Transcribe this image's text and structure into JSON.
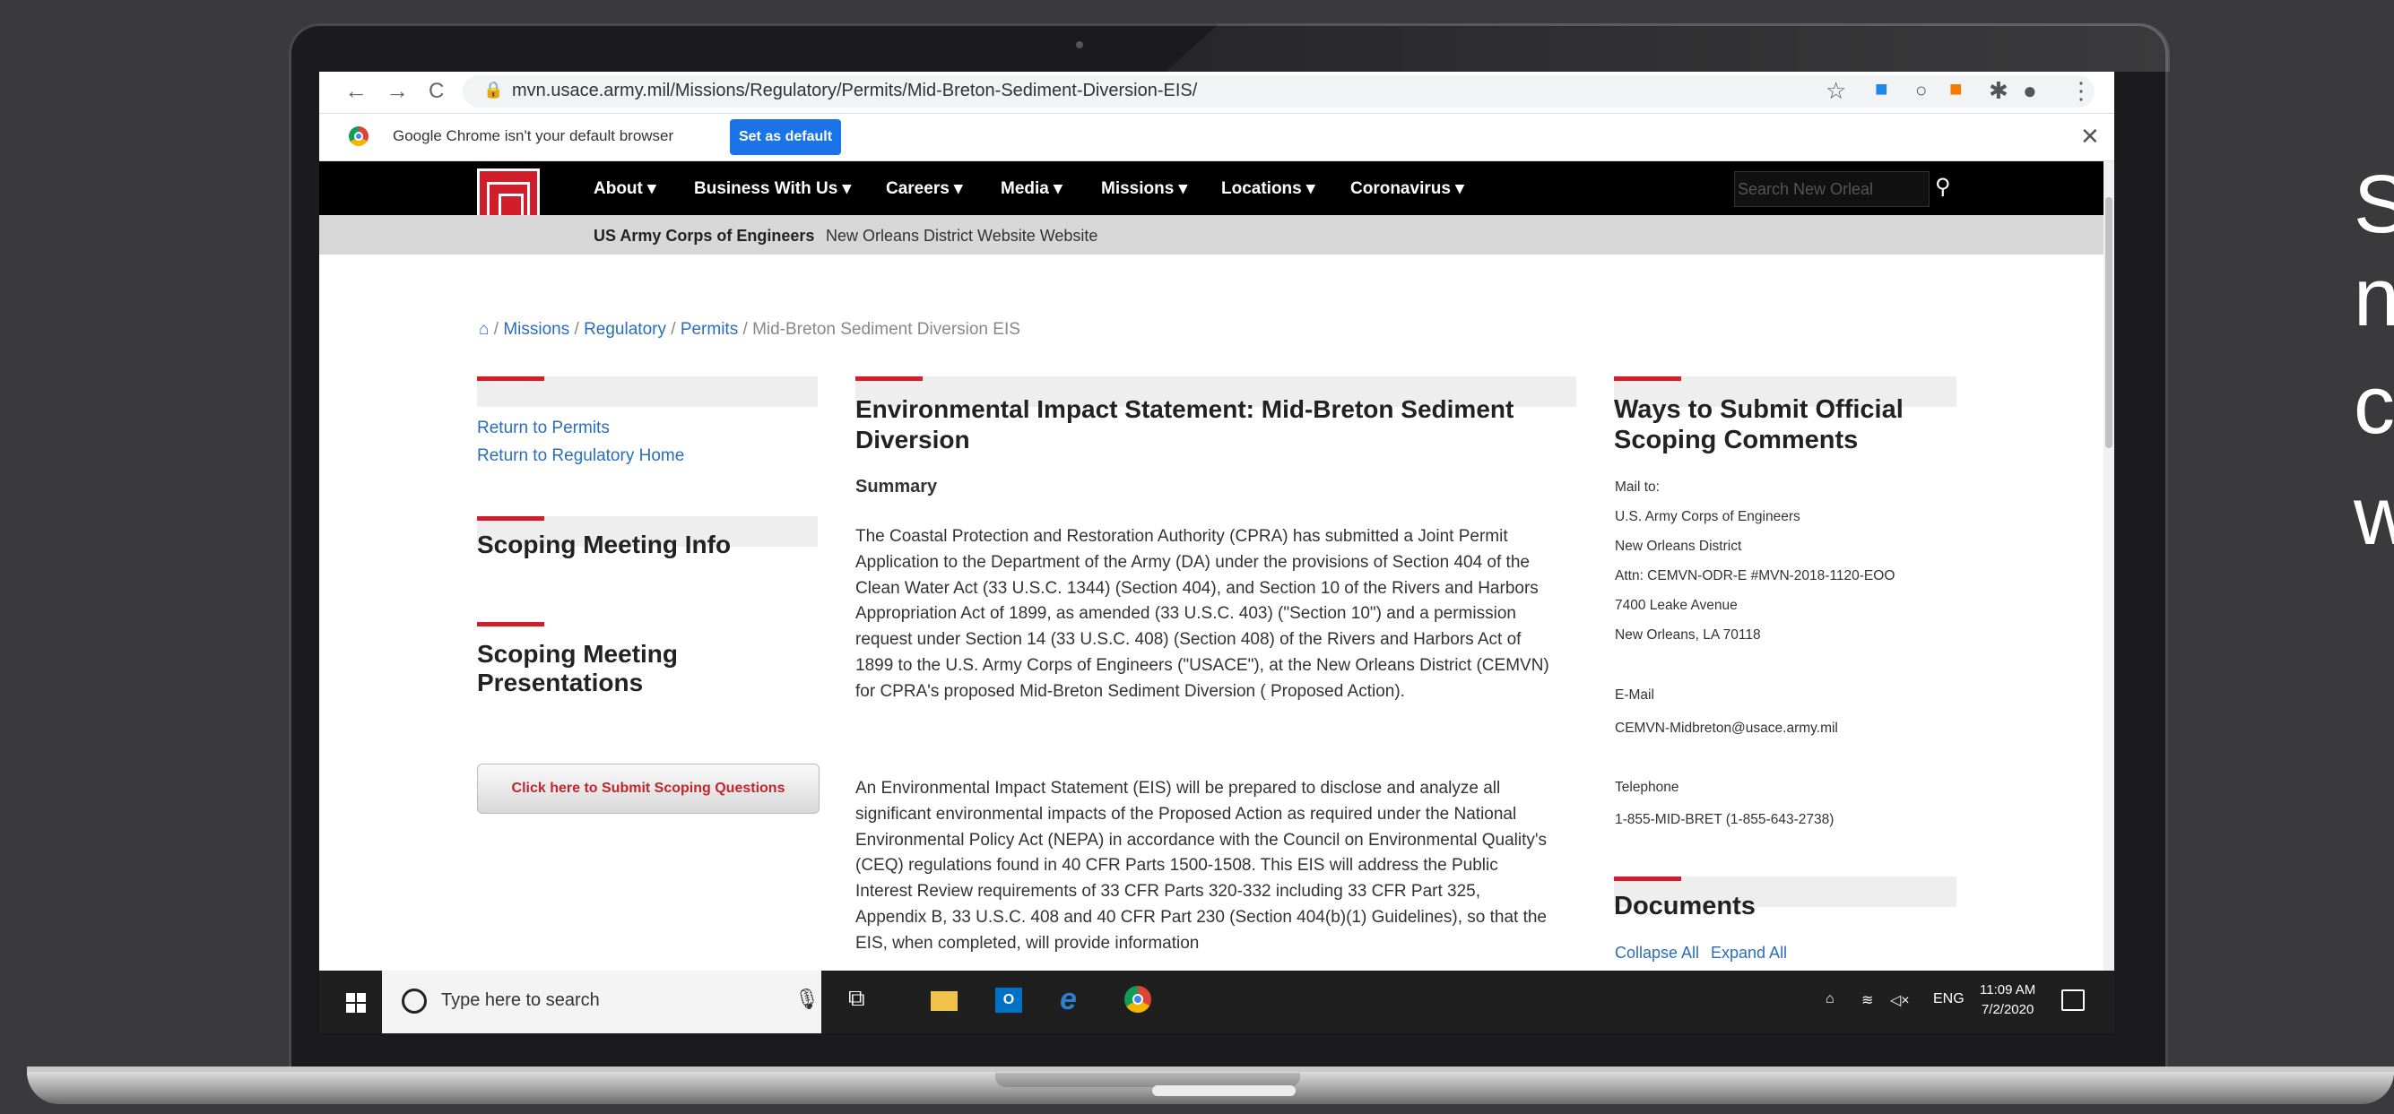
{
  "side_text": [
    "S",
    "n",
    "c",
    "w"
  ],
  "browser": {
    "url": "mvn.usace.army.mil/Missions/Regulatory/Permits/Mid-Breton-Sediment-Diversion-EIS/",
    "infobar_text": "Google Chrome isn't your default browser",
    "set_default_label": "Set as default"
  },
  "site": {
    "menu": [
      "About ▾",
      "Business With Us ▾",
      "Careers ▾",
      "Media ▾",
      "Missions ▾",
      "Locations ▾",
      "Coronavirus ▾"
    ],
    "search_placeholder": "Search New Orleal",
    "org_name": "US Army Corps of Engineers",
    "district_label": "New Orleans District Website Website",
    "logo_sub": "®"
  },
  "breadcrumb": {
    "items": [
      "Missions",
      "Regulatory",
      "Permits"
    ],
    "current": "Mid-Breton Sediment Diversion EIS",
    "sep": "/"
  },
  "left": {
    "links": [
      "Return to Permits",
      "Return to Regulatory Home"
    ],
    "heading1": "Scoping Meeting Info",
    "heading2_line1": "Scoping Meeting",
    "heading2_line2": "Presentations",
    "button": "Click here to Submit Scoping Questions"
  },
  "main": {
    "title_line1": "Environmental Impact Statement: Mid-Breton Sediment",
    "title_line2": "Diversion",
    "summary_label": "Summary",
    "para1": "The Coastal Protection and Restoration Authority (CPRA) has submitted a Joint Permit Application to the Department of the Army (DA) under the provisions of Section 404 of the Clean Water Act (33 U.S.C. 1344) (Section 404), and Section 10 of the Rivers and Harbors Appropriation Act of 1899, as amended (33 U.S.C. 403) (\"Section 10\") and a permission request under Section 14 (33 U.S.C. 408) (Section 408) of the Rivers and Harbors Act of 1899 to the U.S. Army Corps of Engineers (\"USACE\"), at the New Orleans District (CEMVN) for CPRA's proposed Mid-Breton Sediment Diversion  ( Proposed Action).",
    "para2": "An Environmental Impact Statement (EIS) will be prepared to disclose and analyze all significant environmental impacts of the Proposed Action as required under the National Environmental Policy Act (NEPA) in accordance with the Council on Environmental Quality's (CEQ) regulations found in 40 CFR Parts 1500-1508.  This EIS will address the Public Interest Review requirements of 33 CFR Parts 320-332 including 33 CFR Part 325, Appendix B, 33 U.S.C. 408 and 40 CFR Part 230 (Section 404(b)(1) Guidelines), so that the EIS, when completed, will provide information"
  },
  "right": {
    "title_line1": "Ways to Submit Official",
    "title_line2": "Scoping Comments",
    "mail_label": "Mail to:",
    "address": [
      "U.S. Army Corps of Engineers",
      "New Orleans District",
      "Attn: CEMVN-ODR-E #MVN-2018-1120-EOO",
      "7400 Leake Avenue",
      "New Orleans, LA 70118"
    ],
    "email_label": "E-Mail",
    "email": "CEMVN-Midbreton@usace.army.mil",
    "phone_label": "Telephone",
    "phone": "1-855-MID-BRET (1-855-643-2738)",
    "documents_title": "Documents",
    "collapse_all": "Collapse All",
    "expand_all": "Expand All"
  },
  "taskbar": {
    "search_placeholder": "Type here to search",
    "lang": "ENG",
    "time": "11:09 AM",
    "date": "7/2/2020"
  },
  "colors": {
    "usace_red": "#d21e2b",
    "link_blue": "#2a6ebb",
    "chrome_blue": "#1a73e8"
  }
}
